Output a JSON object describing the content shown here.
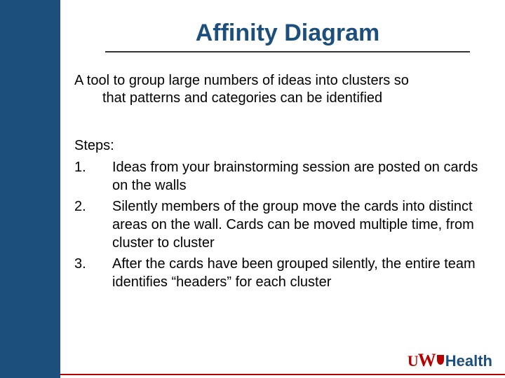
{
  "title": "Affinity Diagram",
  "intro_line1": "A tool to group large numbers of ideas into clusters so",
  "intro_line2": "that patterns and categories can be identified",
  "steps_label": "Steps:",
  "steps": [
    {
      "num": "1.",
      "text": "Ideas from your brainstorming session are posted on cards on the walls"
    },
    {
      "num": "2.",
      "text": "Silently members of the group move the cards into distinct areas on the wall.  Cards can be moved multiple time, from cluster to cluster"
    },
    {
      "num": "3.",
      "text": "After the cards have been grouped silently, the entire team identifies “headers” for each cluster"
    }
  ],
  "logo": {
    "uw": "UW",
    "health": "Health"
  }
}
